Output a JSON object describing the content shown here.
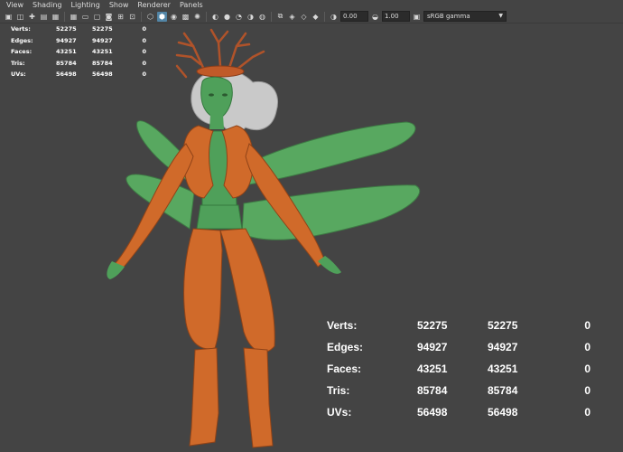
{
  "menubar": {
    "items": [
      "View",
      "Shading",
      "Lighting",
      "Show",
      "Renderer",
      "Panels"
    ]
  },
  "toolbar": {
    "icons": [
      "camera-select-icon",
      "camera-attributes-icon",
      "bookmark-icon",
      "image-plane-icon",
      "grid-2d-icon",
      "grid-icon",
      "film-gate-icon",
      "resolution-gate-icon",
      "gate-mask-icon",
      "field-chart-icon",
      "safe-action-icon",
      "wireframe-icon",
      "smooth-shade-icon",
      "default-material-icon",
      "textured-icon",
      "use-lights-icon",
      "shadows-icon",
      "screen-ao-icon",
      "motion-blur-icon",
      "anti-alias-icon",
      "depth-of-field-icon",
      "isolate-select-icon",
      "xray-icon",
      "xray-joints-icon",
      "backface-culling-icon",
      "exposure-icon",
      "gamma-icon"
    ],
    "exposure_value": "0.00",
    "gamma_value": "1.00",
    "color_space": "sRGB gamma",
    "accent_color": "#5285a6"
  },
  "hud_small": {
    "rows": [
      {
        "label": "Verts:",
        "a": "52275",
        "b": "52275",
        "c": "0"
      },
      {
        "label": "Edges:",
        "a": "94927",
        "b": "94927",
        "c": "0"
      },
      {
        "label": "Faces:",
        "a": "43251",
        "b": "43251",
        "c": "0"
      },
      {
        "label": "Tris:",
        "a": "85784",
        "b": "85784",
        "c": "0"
      },
      {
        "label": "UVs:",
        "a": "56498",
        "b": "56498",
        "c": "0"
      }
    ]
  },
  "hud_large": {
    "rows": [
      {
        "label": "Verts:",
        "a": "52275",
        "b": "52275",
        "c": "0"
      },
      {
        "label": "Edges:",
        "a": "94927",
        "b": "94927",
        "c": "0"
      },
      {
        "label": "Faces:",
        "a": "43251",
        "b": "43251",
        "c": "0"
      },
      {
        "label": "Tris:",
        "a": "85784",
        "b": "85784",
        "c": "0"
      },
      {
        "label": "UVs:",
        "a": "56498",
        "b": "56498",
        "c": "0"
      }
    ]
  },
  "colors": {
    "viewport_bg": "#444444",
    "skin": "#4fa05a",
    "clothing": "#d06a2a",
    "wings": "#58a860",
    "hair": "#c9c9c9",
    "crown": "#c05a28"
  }
}
